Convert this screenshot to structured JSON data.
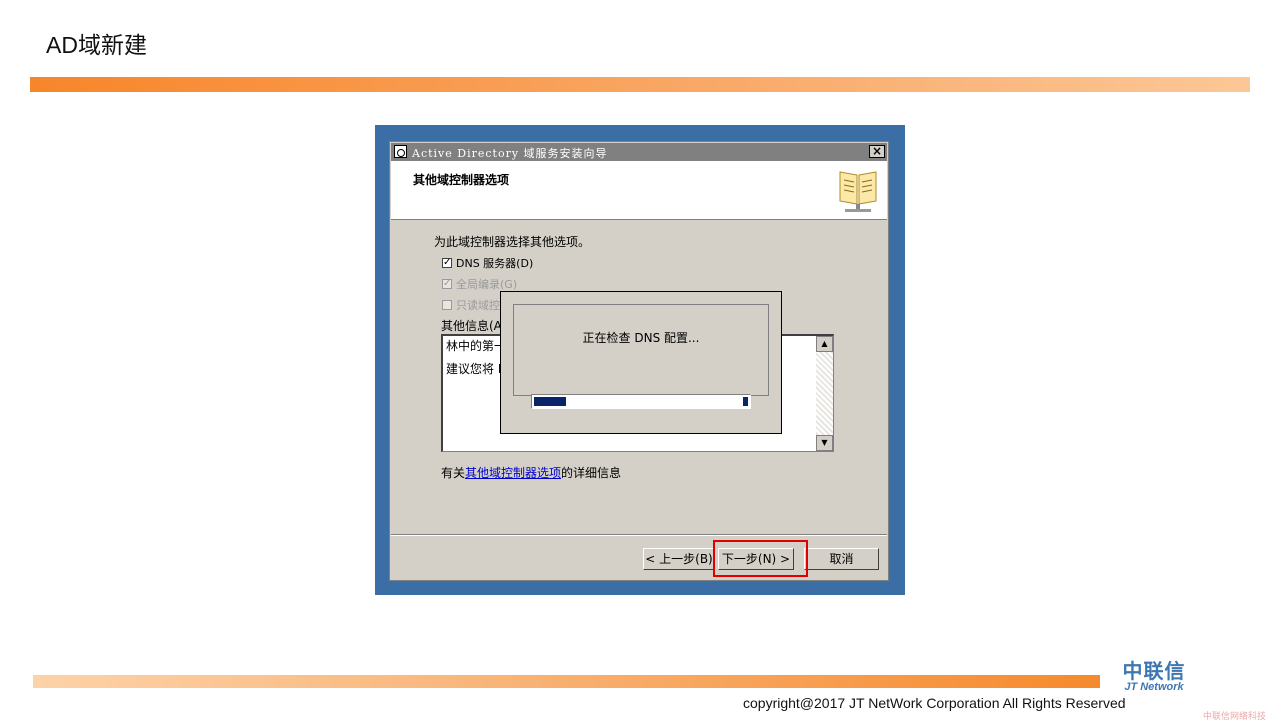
{
  "slide": {
    "title": "AD域新建",
    "copyright": "copyright@2017  JT NetWork Corporation All Rights Reserved",
    "logo_cn": "中联信",
    "logo_en": "JT Network",
    "watermark": "中联信网络科技"
  },
  "window": {
    "title": "Active Directory 域服务安装向导",
    "close_icon": "close-icon",
    "header_title": "其他域控制器选项",
    "header_icon": "book-icon",
    "intro": "为此域控制器选择其他选项。",
    "options": [
      {
        "label": "DNS 服务器(D)",
        "checked": true,
        "enabled": true
      },
      {
        "label": "全局编录(G)",
        "checked": true,
        "enabled": false
      },
      {
        "label": "只读域控",
        "checked": false,
        "enabled": false
      }
    ],
    "info_label": "其他信息(A",
    "info_lines": [
      "林中的第一",
      "建议您将 I"
    ],
    "more_info_prefix": "有关",
    "more_info_link": "其他域控制器选项",
    "more_info_suffix": "的详细信息",
    "buttons": {
      "back": "< 上一步(B)",
      "next": "下一步(N) >",
      "cancel": "取消"
    }
  },
  "progress_dialog": {
    "message": "正在检查 DNS 配置...",
    "progress": 0.15
  },
  "colors": {
    "accent_orange": "#f7862a",
    "desktop_blue": "#3a6ea5",
    "highlight_red": "#e00000",
    "progress_blue": "#0a246a"
  }
}
